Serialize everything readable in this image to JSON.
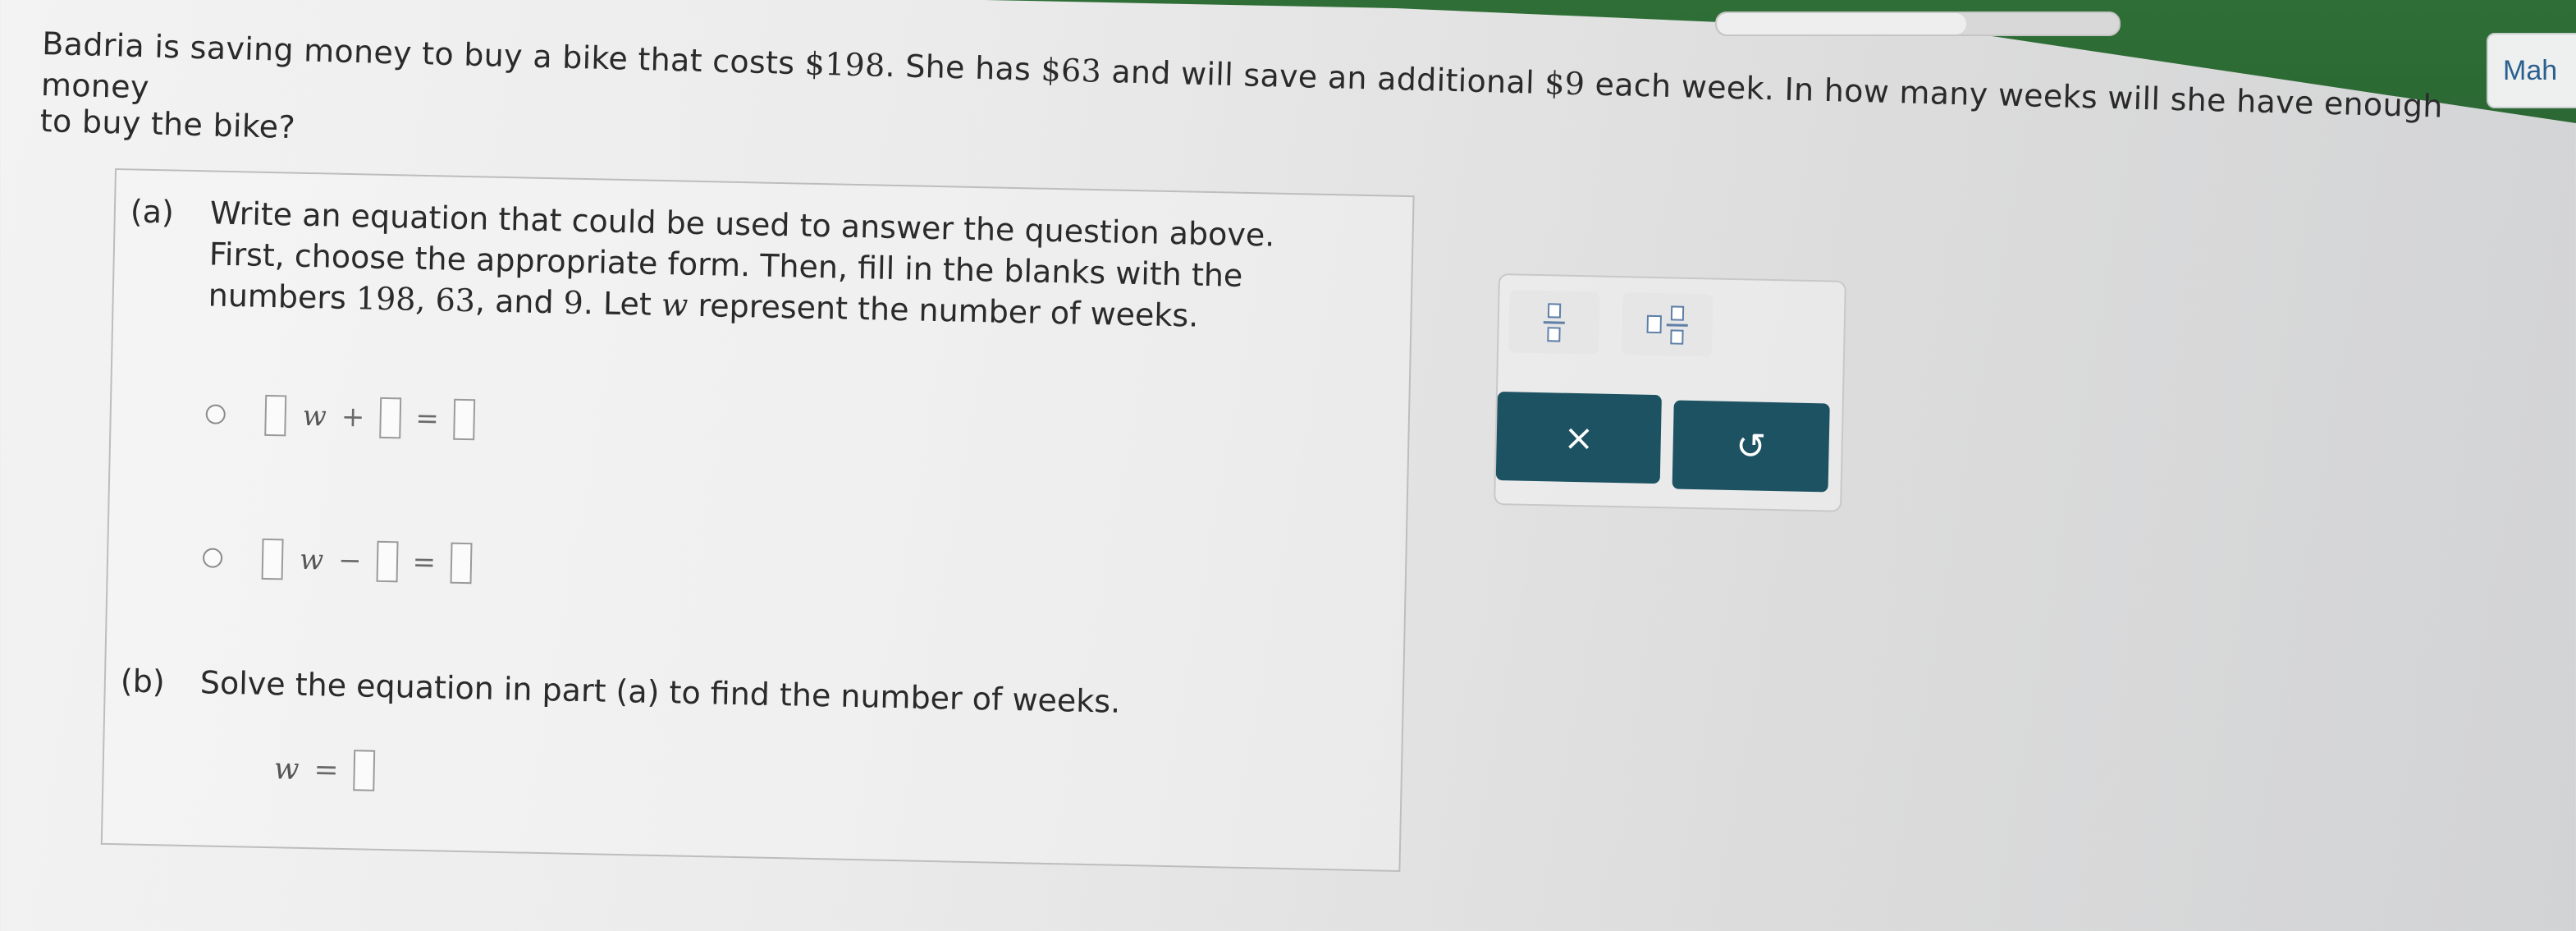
{
  "header": {
    "user_button_label": "Mah",
    "progress_fraction": 0.62
  },
  "question": {
    "line1_part1": "Badria is saving money to buy a bike that costs ",
    "cost": "$198",
    "line1_part2": ". She has ",
    "savings": "$63",
    "line1_part3": " and will save an additional ",
    "weekly": "$9",
    "line1_part4": " each week. In how many weeks will she have enough money",
    "line2": "to buy the bike?"
  },
  "part_a": {
    "label": "(a)",
    "line1": "Write an equation that could be used to answer the question above.",
    "line2": "First, choose the appropriate form. Then, fill in the blanks with the",
    "line3_prefix": "numbers ",
    "num1": "198",
    "sep1": ", ",
    "num2": "63",
    "sep2": ", and ",
    "num3": "9",
    "line3_mid": ". Let ",
    "var": "w",
    "line3_suffix": " represent the number of weeks.",
    "options": [
      {
        "var": "w",
        "operator": "+",
        "equals": "="
      },
      {
        "var": "w",
        "operator": "−",
        "equals": "="
      }
    ]
  },
  "part_b": {
    "label": "(b)",
    "text": "Solve the equation in part (a) to find the number of weeks.",
    "answer_var": "w",
    "answer_equals": "="
  },
  "toolbox": {
    "fraction_tool": "fraction-icon",
    "mixed_number_tool": "mixed-number-icon",
    "clear_label": "×",
    "undo_label": "↺"
  },
  "colors": {
    "header_green": "#2f6f37",
    "button_teal": "#1d5263",
    "icon_blue": "#5d7fa8"
  }
}
